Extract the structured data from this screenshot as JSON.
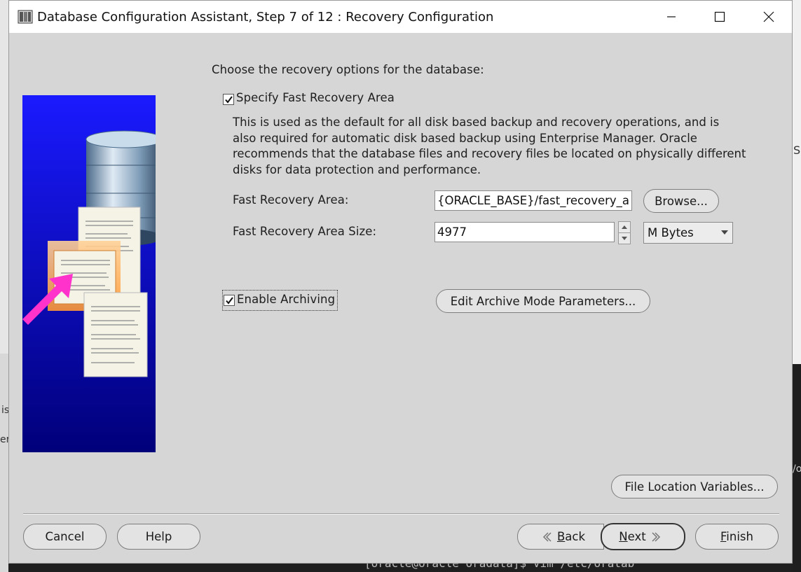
{
  "window": {
    "title": "Database Configuration Assistant, Step 7 of 12 : Recovery Configuration"
  },
  "main": {
    "intro": "Choose the recovery options for the database:",
    "fra_checkbox": {
      "label": "Specify Fast Recovery Area",
      "checked": true
    },
    "description_lines": [
      "This is used as the default for all disk based backup and recovery operations, and is",
      "also required for automatic disk based backup using Enterprise Manager. Oracle",
      "recommends that the database files and recovery files be located on physically different",
      "disks for data protection and performance."
    ],
    "fra_location": {
      "label": "Fast Recovery Area:",
      "value": "{ORACLE_BASE}/fast_recovery_a",
      "browse_label": "Browse..."
    },
    "fra_size": {
      "label": "Fast Recovery Area Size:",
      "value": "4977",
      "unit": "M Bytes"
    },
    "archiving_checkbox": {
      "label": "Enable Archiving",
      "checked": true
    },
    "archive_params_label": "Edit Archive Mode Parameters...",
    "file_location_vars_label": "File Location Variables..."
  },
  "footer": {
    "cancel": "Cancel",
    "help": "Help",
    "back_mnemonic": "B",
    "back_rest": "ack",
    "next_mnemonic": "N",
    "next_rest": "ext",
    "finish_mnemonic": "F",
    "finish_rest": "inish"
  },
  "background": {
    "terminal_line": "[oracle@oracle oradata]$ vim /etc/oratab",
    "left_fragment_1": "is",
    "left_fragment_2": "er",
    "right_fragment_1": "S",
    "right_fragment_2": "/o"
  },
  "colors": {
    "image_blue_top": "#1a1aff",
    "image_blue_bottom": "#00007a",
    "arrow_magenta": "#ff33cc",
    "dialog_bg": "#d6d6d6"
  }
}
